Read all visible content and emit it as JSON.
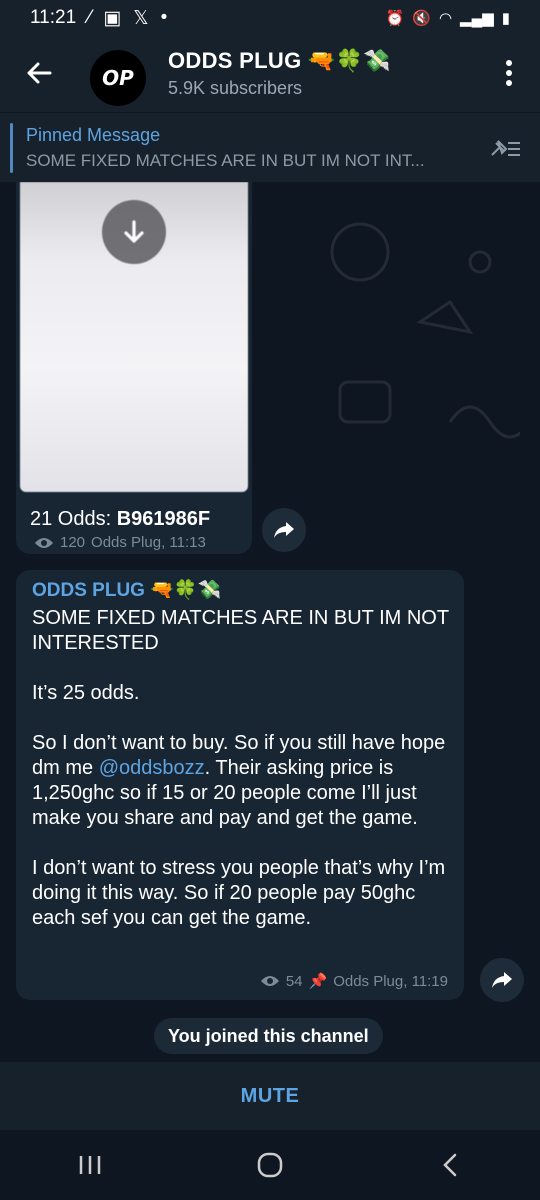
{
  "status": {
    "time": "11:21",
    "left_icons": [
      "signal-icon",
      "gallery-icon",
      "x-icon",
      "dot-icon"
    ],
    "right_icons": [
      "alarm-icon",
      "mute-icon",
      "wifi-icon",
      "signal-bars-icon",
      "battery-icon"
    ]
  },
  "header": {
    "avatar_text": "OP",
    "title": "ODDS PLUG 🔫🍀💸",
    "subtitle": "5.9K subscribers"
  },
  "pinned": {
    "label": "Pinned Message",
    "text": "SOME FIXED MATCHES ARE IN BUT IM NOT INT..."
  },
  "messages": [
    {
      "odds_label": "21 Odds: ",
      "odds_code": "B961986F",
      "views": "120",
      "author_time": "Odds Plug, 11:13"
    },
    {
      "sender": "ODDS PLUG 🔫🍀💸",
      "body_1": "SOME FIXED MATCHES ARE IN BUT IM NOT INTERESTED\n\nIt’s 25 odds.\n\nSo I don’t want to buy. So if you still have hope dm me ",
      "mention": "@oddsbozz",
      "body_2": ". Their asking price is 1,250ghc so if 15 or 20 people come I’ll just make you share and pay and get the game.\n\nI don’t want to stress you people that’s why I’m doing it this way. So if 20 people pay 50ghc each sef you can get the game.",
      "views": "54",
      "author_time": "Odds Plug, 11:19"
    }
  ],
  "service": {
    "joined": "You joined this channel"
  },
  "footer": {
    "mute_label": "MUTE"
  },
  "colors": {
    "accent": "#5ea4e2",
    "bubble": "#182533",
    "chat_bg": "#0e1621",
    "header_bg": "#17212b"
  }
}
